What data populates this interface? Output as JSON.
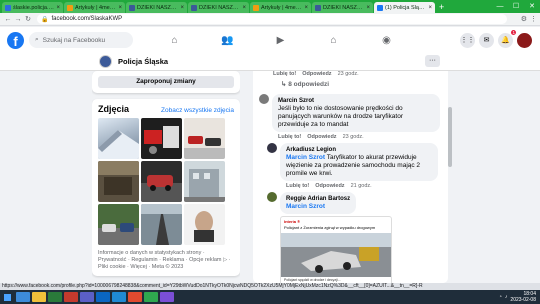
{
  "browser": {
    "tabs": [
      {
        "label": "ślaskie.policja.gov.pl",
        "color": "#2d6cdf",
        "active": false
      },
      {
        "label": "Artykuły | 4media",
        "color": "#f39c12",
        "active": false
      },
      {
        "label": "DZIEKI NASZEJ P",
        "color": "#3b5998",
        "active": false
      },
      {
        "label": "DZIEKI NASZEJ P",
        "color": "#3b5998",
        "active": false
      },
      {
        "label": "Artykuły | 4media",
        "color": "#f39c12",
        "active": false
      },
      {
        "label": "DZIEKI NASZEJ P",
        "color": "#3b5998",
        "active": false
      },
      {
        "label": "(1) Policja Śląska",
        "color": "#1877f2",
        "active": true
      }
    ],
    "new_tab": "+",
    "window_controls": [
      "—",
      "☐",
      "✕"
    ],
    "url": "facebook.com/SlaskaKWP",
    "status_url": "https://www.facebook.com/profile.php?id=100006798248838&comment_id=Y29tbWVudDo1NTkyOTk0NjcwNDQ5OTk2XzU5MjY0MjExNjUxMzc1NzQ%3D&__cft__[0]=AZUIT...&__tn__=R]-R"
  },
  "fb": {
    "search_placeholder": "Szukaj na Facebooku",
    "notif_count": "1"
  },
  "page": {
    "name": "Policja Śląska",
    "more": "···"
  },
  "left": {
    "propose_label": "Zaproponuj zmiany",
    "photos_title": "Zdjęcia",
    "photos_link": "Zobacz wszystkie zdjęcia",
    "footer": "Informacje o danych w statystykach strony · Prywatność · Regulamin · Reklama · Opcje reklam ▷ · Pliki cookie · Więcej · Meta © 2023"
  },
  "comments": {
    "top_actions": {
      "like": "Lubię to!",
      "reply": "Odpowiedz",
      "time": "23 godz."
    },
    "replies_label": "↳ 8 odpowiedzi",
    "items": [
      {
        "author": "Marcin Szrot",
        "text": "Jeśli było to nie dostosowanie prędkości do panujących warunków na drodze taryfikator przewiduje za to mandat",
        "like": "Lubię to!",
        "reply": "Odpowiedz",
        "time": "23 godz."
      },
      {
        "author": "Arkadiusz Legion",
        "tag": "Marcin Szrot",
        "text": "Taryfikator to akurat przewiduje więzienie za prowadzenie samochodu mając 2 promile we krwi.",
        "like": "Lubię to!",
        "reply": "Odpowiedz",
        "time": "21 godz."
      },
      {
        "author": "Reggie Adrian Bartosz",
        "tag": "Marcin Szrot",
        "shot_source": "Interia ®",
        "shot_headline": "Policjant z Żorzmienia zginął w wypadku drogowym",
        "shot_caption": "Policjant spędził w drodze i decyzji..."
      }
    ]
  },
  "taskbar": {
    "time": "18:04",
    "date": "2023-02-08"
  }
}
